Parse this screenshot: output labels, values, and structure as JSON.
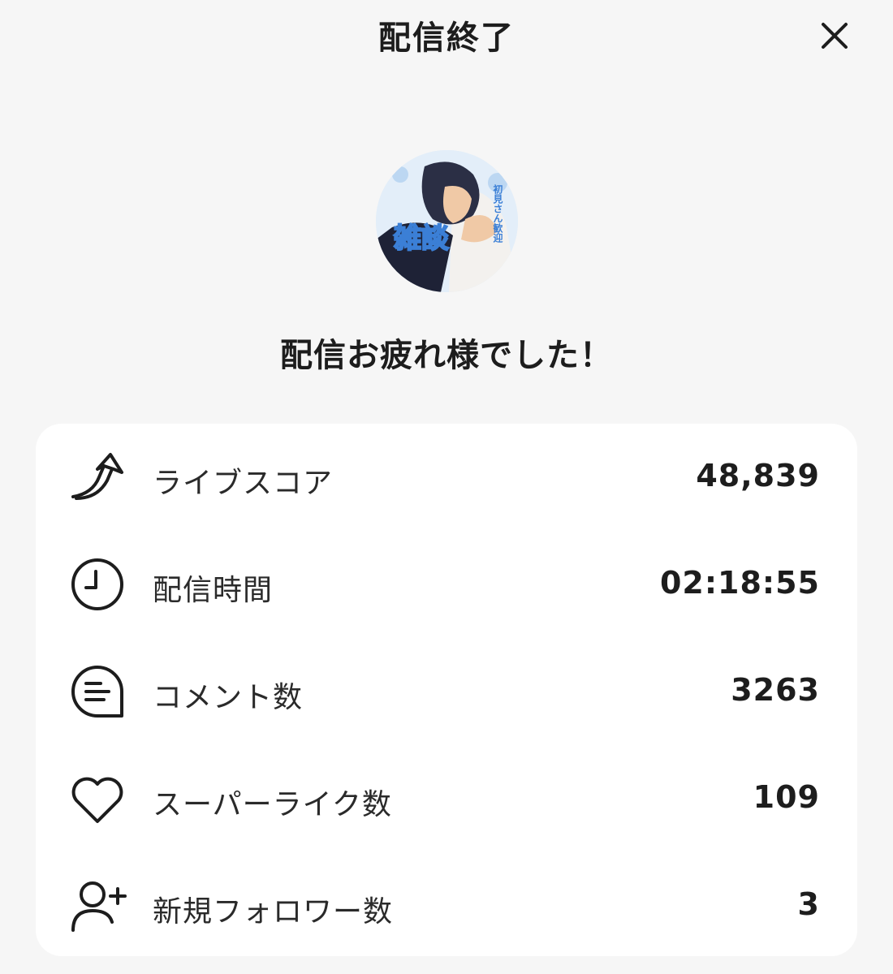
{
  "header": {
    "title": "配信終了",
    "close_icon": "close-icon"
  },
  "avatar": {
    "overlay_text": "雑談",
    "side_text": "初見さん歓迎"
  },
  "headline": "配信お疲れ様でした！",
  "stats": [
    {
      "icon": "trending-arrow-icon",
      "label": "ライブスコア",
      "value": "48,839"
    },
    {
      "icon": "clock-icon",
      "label": "配信時間",
      "value": "02:18:55"
    },
    {
      "icon": "comment-icon",
      "label": "コメント数",
      "value": "3263"
    },
    {
      "icon": "heart-icon",
      "label": "スーパーライク数",
      "value": "109"
    },
    {
      "icon": "add-user-icon",
      "label": "新規フォロワー数",
      "value": "3"
    }
  ],
  "colors": {
    "background": "#f6f6f6",
    "card": "#ffffff",
    "text": "#1d1d1d",
    "avatar_accent": "#3b7fd6"
  }
}
